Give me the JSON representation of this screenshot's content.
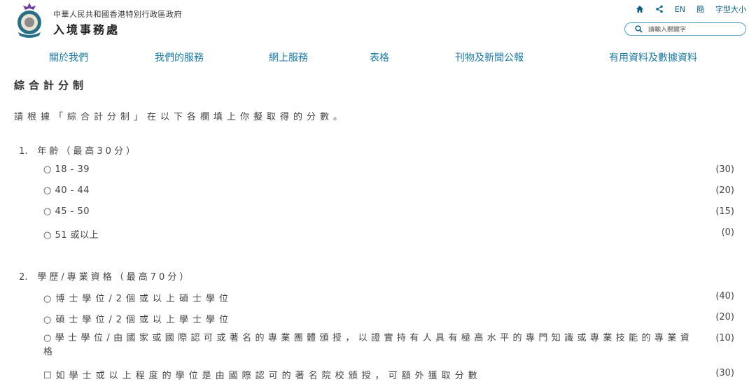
{
  "header": {
    "gov_name": "中華人民共和國香港特別行政區政府",
    "dept_name": "入境事務處",
    "utilities": {
      "home_icon": "home-icon",
      "share_icon": "share-icon",
      "english": "EN",
      "simplified": "簡",
      "font_size": "字型大小"
    },
    "search": {
      "placeholder": "請輸入關鍵字"
    }
  },
  "nav": {
    "items": [
      {
        "label": "關於我們"
      },
      {
        "label": "我們的服務"
      },
      {
        "label": "網上服務"
      },
      {
        "label": "表格"
      },
      {
        "label": "刊物及新聞公報"
      },
      {
        "label": "有用資料及數據資料"
      }
    ]
  },
  "main": {
    "title": "綜合計分制",
    "intro": "請根據「綜合計分制」在以下各欄填上你擬取得的分數。",
    "sections": [
      {
        "number": "1.",
        "heading": "年齡（最高30分）",
        "options": [
          {
            "label": "○ 18 - 39",
            "points": "(30)"
          },
          {
            "label": "○ 40 - 44",
            "points": "(20)"
          },
          {
            "label": "○ 45 - 50",
            "points": "(15)"
          },
          {
            "label": "○ 51 或以上",
            "points": "(0)"
          }
        ]
      },
      {
        "number": "2.",
        "heading": "學歷/專業資格（最高70分）",
        "options": [
          {
            "label": "○博士學位/2個或以上碩士學位",
            "points": "(40)"
          },
          {
            "label": "○碩士學位/2個或以上學士學位",
            "points": "(20)"
          },
          {
            "label": "○學士學位/由國家或國際認可或著名的專業團體頒授，以證實持有人具有極高水平的專門知識或專業技能的專業資格",
            "points": "(10)"
          },
          {
            "label": "☐如學士或以上程度的學位是由國際認可的著名院校頒授，可額外獲取分數",
            "points": "(30)"
          }
        ]
      }
    ]
  },
  "colors": {
    "accent": "#1b7aa7",
    "text": "#444444",
    "search_border": "#4f9fc1"
  }
}
